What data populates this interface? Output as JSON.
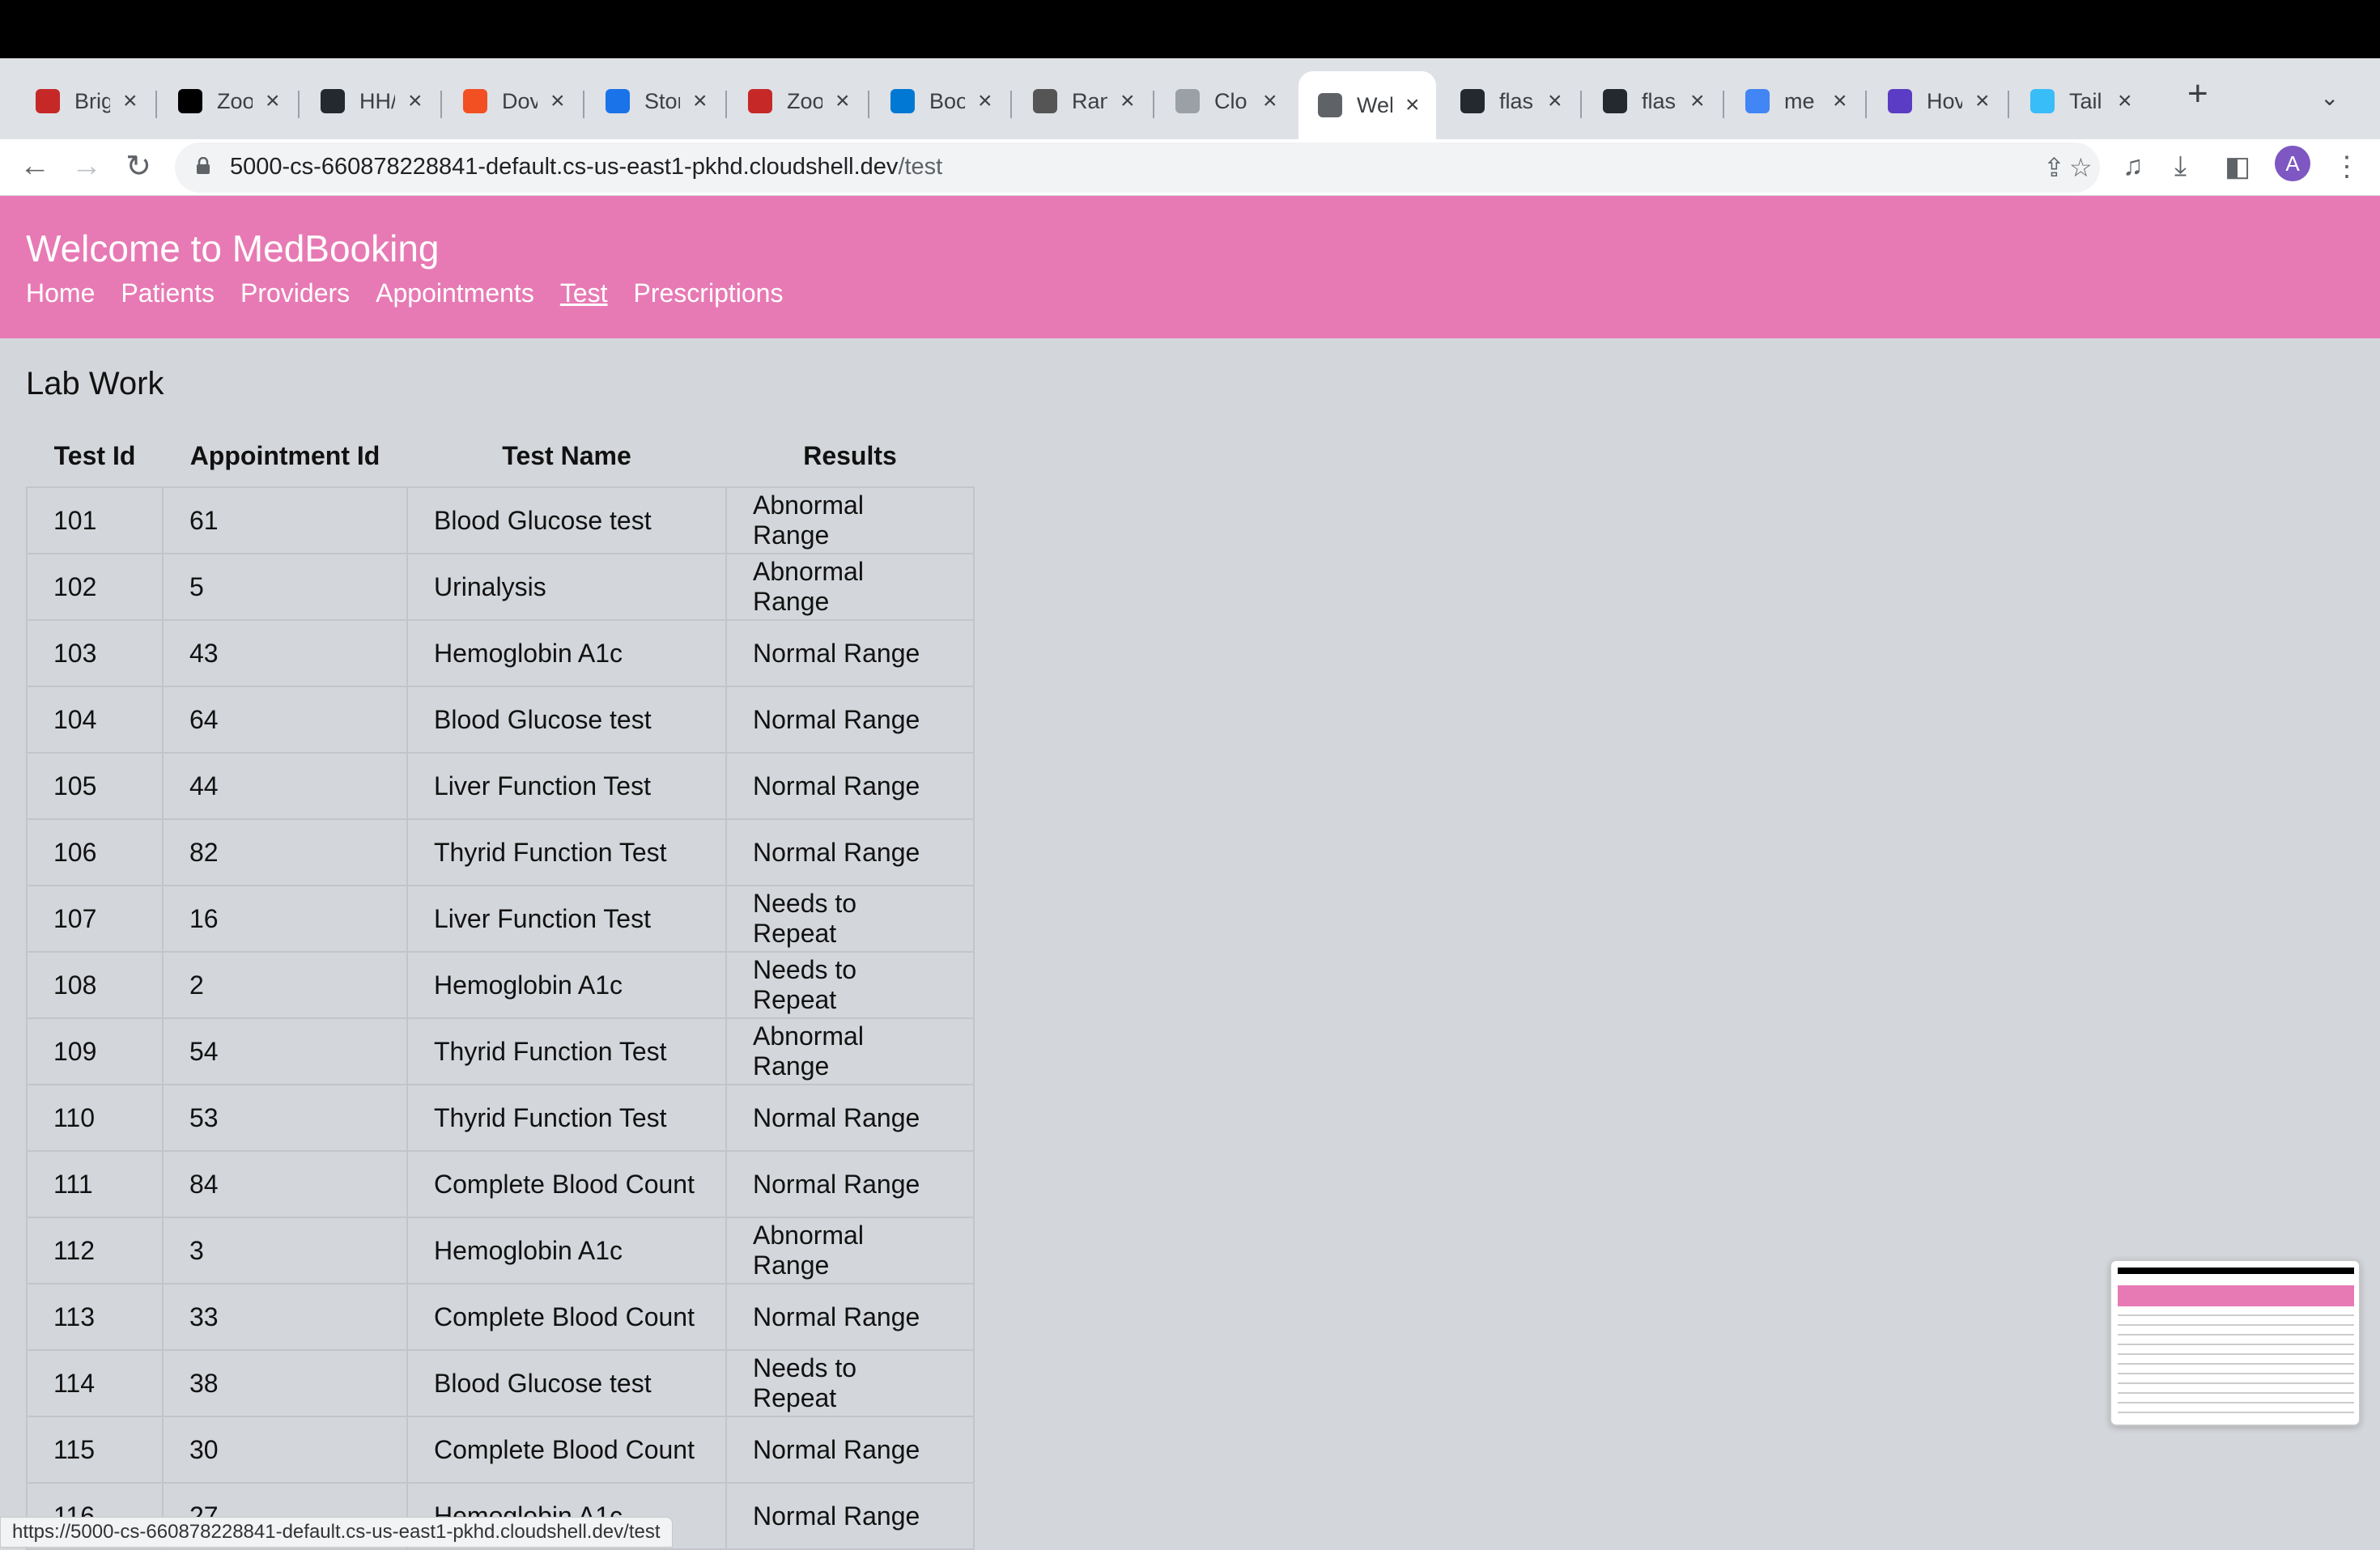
{
  "browser": {
    "tabs": [
      {
        "label": "Brig",
        "icon": "shield-red-icon",
        "color": "#c62828"
      },
      {
        "label": "Zoo",
        "icon": "d2l-icon",
        "color": "#000000"
      },
      {
        "label": "HH/",
        "icon": "github-icon",
        "color": "#24292f"
      },
      {
        "label": "Dov",
        "icon": "microsoft-icon",
        "color": "#f25022"
      },
      {
        "label": "Stor",
        "icon": "calendar-icon",
        "color": "#1a73e8"
      },
      {
        "label": "Zoo",
        "icon": "shield-red-icon",
        "color": "#c62828"
      },
      {
        "label": "Boo",
        "icon": "azure-icon",
        "color": "#0078d4"
      },
      {
        "label": "Ran",
        "icon": "horse-icon",
        "color": "#555555"
      },
      {
        "label": "Clo",
        "icon": "cloud-shell-icon",
        "color": "#9aa0a6"
      },
      {
        "label": "Wel",
        "icon": "globe-icon",
        "color": "#5f6368",
        "active": true
      },
      {
        "label": "flas",
        "icon": "github-icon",
        "color": "#24292f"
      },
      {
        "label": "flas",
        "icon": "github-icon",
        "color": "#24292f"
      },
      {
        "label": "me",
        "icon": "google-icon",
        "color": "#4285f4"
      },
      {
        "label": "Hov",
        "icon": "bookmark-purple-icon",
        "color": "#5b3cc4"
      },
      {
        "label": "Tail",
        "icon": "tailwind-icon",
        "color": "#38bdf8"
      }
    ],
    "url_host": "5000-cs-660878228841-default.cs-us-east1-pkhd.cloudshell.dev",
    "url_path": "/test",
    "avatar_letter": "A",
    "status_url": "https://5000-cs-660878228841-default.cs-us-east1-pkhd.cloudshell.dev/test"
  },
  "site": {
    "title": "Welcome to MedBooking",
    "nav": [
      "Home",
      "Patients",
      "Providers",
      "Appointments",
      "Test",
      "Prescriptions"
    ],
    "accent": "#e77ab4"
  },
  "main": {
    "heading": "Lab Work",
    "columns": [
      "Test Id",
      "Appointment Id",
      "Test Name",
      "Results"
    ],
    "rows": [
      [
        "101",
        "61",
        "Blood Glucose test",
        "Abnormal Range"
      ],
      [
        "102",
        "5",
        "Urinalysis",
        "Abnormal Range"
      ],
      [
        "103",
        "43",
        "Hemoglobin A1c",
        "Normal Range"
      ],
      [
        "104",
        "64",
        "Blood Glucose test",
        "Normal Range"
      ],
      [
        "105",
        "44",
        "Liver Function Test",
        "Normal Range"
      ],
      [
        "106",
        "82",
        "Thyrid Function Test",
        "Normal Range"
      ],
      [
        "107",
        "16",
        "Liver Function Test",
        "Needs to Repeat"
      ],
      [
        "108",
        "2",
        "Hemoglobin A1c",
        "Needs to Repeat"
      ],
      [
        "109",
        "54",
        "Thyrid Function Test",
        "Abnormal Range"
      ],
      [
        "110",
        "53",
        "Thyrid Function Test",
        "Normal Range"
      ],
      [
        "111",
        "84",
        "Complete Blood Count",
        "Normal Range"
      ],
      [
        "112",
        "3",
        "Hemoglobin A1c",
        "Abnormal Range"
      ],
      [
        "113",
        "33",
        "Complete Blood Count",
        "Normal Range"
      ],
      [
        "114",
        "38",
        "Blood Glucose test",
        "Needs to Repeat"
      ],
      [
        "115",
        "30",
        "Complete Blood Count",
        "Normal Range"
      ],
      [
        "116",
        "27",
        "Hemoglobin A1c",
        "Normal Range"
      ]
    ]
  }
}
